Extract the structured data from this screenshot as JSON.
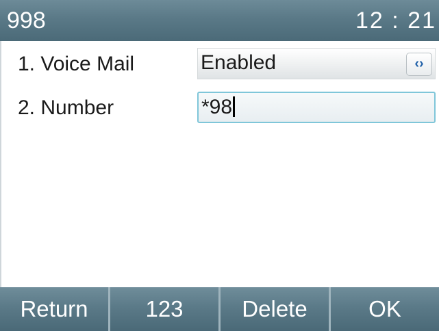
{
  "header": {
    "title": "998",
    "time": "12 : 21"
  },
  "settings": [
    {
      "label": "1.  Voice Mail",
      "value": "Enabled",
      "control": "select",
      "icon": "switch-arrows-icon"
    },
    {
      "label": "2.  Number",
      "value": "*98",
      "control": "input",
      "focused": true
    }
  ],
  "softkeys": [
    "Return",
    "123",
    "Delete",
    "OK"
  ],
  "colors": {
    "bar_background": "#5a7987",
    "focus_border": "#7fc6d9",
    "switch_icon": "#1f5fa8"
  }
}
